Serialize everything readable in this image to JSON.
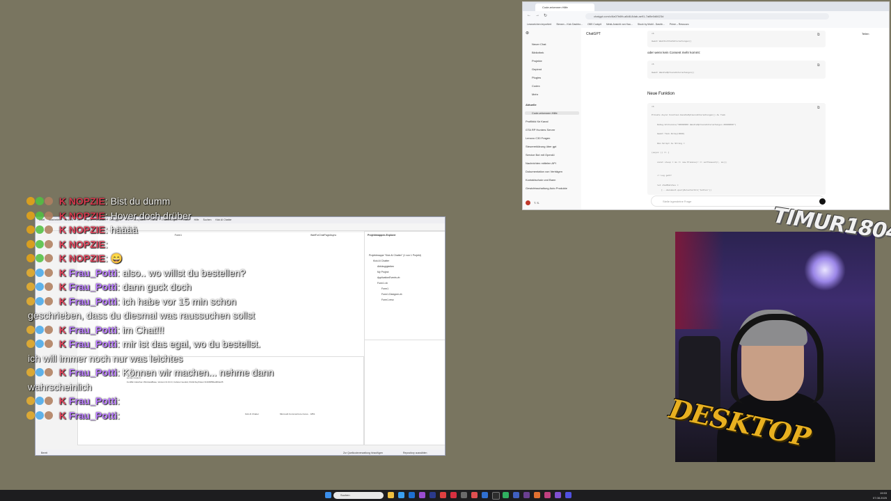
{
  "browser": {
    "tab_title": "Code-erkennen Hilfe",
    "url": "chatgpt.com/c/6a07b6fb-a8d8-8dab-ae91-7af8e0d6623d",
    "bookmarks": [
      "Lesezeichen importiert",
      "Stream – Kick Dashbo...",
      "OBS Cockpit",
      "Meist-Ansicht von Hau...",
      "Stock by Mobil - Dashb...",
      "Prime – Ressourc"
    ]
  },
  "chatgpt": {
    "brand": "ChatGPT",
    "share": "Teilen",
    "nav": [
      "Neuer Chat",
      "Bibliothek",
      "Projekte",
      "Gepinnt",
      "Plugins",
      "Codex",
      "Mehr"
    ],
    "recent_label": "Aktuelle",
    "recent": [
      "Code-erkennen Hilfe",
      "Profilbild für Kanal",
      "GTA RP Hunters Server",
      "Lenovo C30 Fragen",
      "Steuererklärung über gpt",
      "Service Bot mit OpenAI",
      "Nachrichten mittelen API",
      "Dokumentation von Verträgen",
      "Kontaktschutz und Bann",
      "Gewichtsschaltung Auto Produkte"
    ],
    "user": "T. S.",
    "code1_lines": [
      "vb",
      "Await WaitForChatUnterachungen()"
    ],
    "text1": "oder wenn kein Consent mehr kommt:",
    "code2_lines": [
      "vb",
      "Await HandleOptionsUnterachungen()"
    ],
    "heading": "Neue Funktion",
    "code3_lines": [
      "vb",
      "Private Async Function HandleOptionsUnterachungen() As Task",
      "Debug.WriteLine(\"######## HandleOptionsUnterachungen ########\")",
      "Await Task.Delay(3000)",
      "Dim Script As String =",
      "(async () => {",
      "const sleep = ms => new Promise(r => setTimeout(r, ms));",
      "// Log geht!",
      "let chatMatches =",
      "[...document.querySelectorAll('button'))"
    ],
    "composer_placeholder": "Stelle irgendeine Frage"
  },
  "vs": {
    "menu": [
      "Datei",
      "Bearbeiten",
      "Ansicht",
      "Git",
      "Projekt",
      "Erstellen",
      "Debuggen",
      "Test",
      "Analysieren",
      "Extras",
      "Erweiterungen",
      "Fenster",
      "Hilfe",
      "Suchen",
      "Kick AI Chatter"
    ],
    "solution_title": "Projektmappen-Explorer",
    "tree": [
      "Projektmappe \"Kick AI Chatter\" (1 von 1 Projekt)",
      "Kick AI Chatter",
      "Abhängigkeiten",
      "My Project",
      "ApplicationEvents.vb",
      "Form1.vb",
      "Form1",
      "Form1.Designer.vb",
      "Form1.resx"
    ],
    "editor_tabs": [
      "Form1",
      "WaitForChatPageAsync"
    ],
    "output_lines": [
      "Kick AI Chatter",
      "Microsoft.CommonCore.Cures... 1851",
      "werden kopiert...",
      "Conflikt zwischen WindowsBase, Version=4.0.0.0, Culture=neutral, PublicKeyToken=31bf3856ad364e35"
    ],
    "status_ready": "Bereit",
    "status_git": "Zur Quellcodeverwaltung hinzufügen",
    "status_repo": "Repository auswählen"
  },
  "chat": [
    {
      "user": "NOPZIE",
      "text": ": Bist du dumm",
      "color": "#e0304a"
    },
    {
      "user": "NOPZIE",
      "text": ": Hover doch drüber",
      "color": "#e0304a"
    },
    {
      "user": "NOPZIE",
      "text": ": hääää",
      "color": "#e0304a"
    },
    {
      "user": "NOPZIE",
      "text": ": ",
      "color": "#e0304a"
    },
    {
      "user": "NOPZIE",
      "text": ": 😄",
      "color": "#e0304a"
    },
    {
      "user": "Frau_Potti",
      "text": ": also.. wo willst du bestellen?",
      "color": "#b26bff"
    },
    {
      "user": "Frau_Potti",
      "text": ": dann guck doch",
      "color": "#b26bff"
    },
    {
      "user": "Frau_Potti",
      "text": ": ich habe vor 15 min schon",
      "color": "#b26bff"
    },
    {
      "user": "",
      "text": "geschrieben, dass du diesmal was raussuchen sollst",
      "color": ""
    },
    {
      "user": "Frau_Potti",
      "text": ": im Chat!!!",
      "color": "#b26bff"
    },
    {
      "user": "Frau_Potti",
      "text": ": mir ist das egal, wo du bestellst.",
      "color": "#b26bff"
    },
    {
      "user": "",
      "text": "ich will immer noch nur was leichtes",
      "color": ""
    },
    {
      "user": "Frau_Potti",
      "text": ": Können wir machen... nehme dann",
      "color": "#b26bff"
    },
    {
      "user": "",
      "text": "wahrscheinlich",
      "color": ""
    },
    {
      "user": "Frau_Potti",
      "text": ": ",
      "color": "#b26bff"
    },
    {
      "user": "Frau_Potti",
      "text": ": ",
      "color": "#b26bff"
    }
  ],
  "webcam": {
    "logo_top": "TIMUR1804",
    "logo_bottom": "DESKTOP"
  },
  "taskbar": {
    "search": "Suchen",
    "time": "19:53",
    "date": "07.08.2025"
  }
}
